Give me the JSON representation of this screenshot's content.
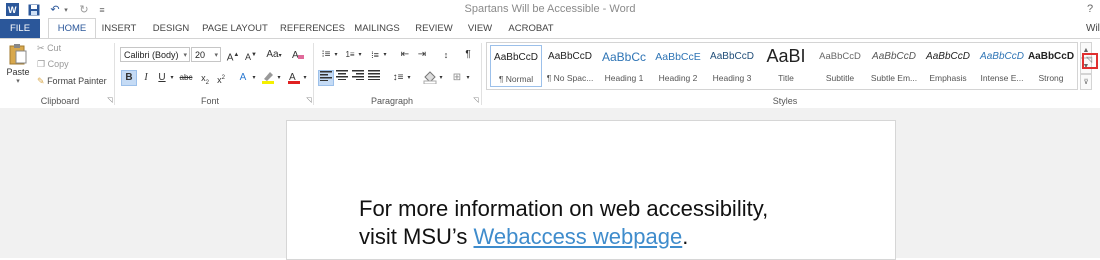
{
  "window": {
    "title": "Spartans Will be Accessible - Word",
    "help": "?",
    "user": "Wil"
  },
  "quick_access": [
    {
      "icon": "word-icon"
    },
    {
      "icon": "save-icon"
    },
    {
      "icon": "undo-icon"
    },
    {
      "icon": "redo-icon"
    },
    {
      "icon": "customize-icon"
    }
  ],
  "tabs": [
    "FILE",
    "HOME",
    "INSERT",
    "DESIGN",
    "PAGE LAYOUT",
    "REFERENCES",
    "MAILINGS",
    "REVIEW",
    "VIEW",
    "ACROBAT"
  ],
  "active_tab": "HOME",
  "clipboard": {
    "paste": "Paste",
    "cut": "Cut",
    "copy": "Copy",
    "format_painter": "Format Painter",
    "label": "Clipboard"
  },
  "font": {
    "family": "Calibri (Body)",
    "size": "20",
    "change_case": "Aa",
    "label": "Font"
  },
  "paragraph": {
    "label": "Paragraph"
  },
  "styles": {
    "label": "Styles",
    "items": [
      {
        "preview": "AaBbCcD",
        "name": "¶ Normal"
      },
      {
        "preview": "AaBbCcD",
        "name": "¶ No Spac..."
      },
      {
        "preview": "AaBbCc",
        "name": "Heading 1"
      },
      {
        "preview": "AaBbCcE",
        "name": "Heading 2"
      },
      {
        "preview": "AaBbCcD",
        "name": "Heading 3"
      },
      {
        "preview": "AaBI",
        "name": "Title"
      },
      {
        "preview": "AaBbCcD",
        "name": "Subtitle"
      },
      {
        "preview": "AaBbCcD",
        "name": "Subtle Em..."
      },
      {
        "preview": "AaBbCcD",
        "name": "Emphasis"
      },
      {
        "preview": "AaBbCcD",
        "name": "Intense E..."
      },
      {
        "preview": "AaBbCcD",
        "name": "Strong"
      }
    ]
  },
  "document": {
    "line1": "For more information on web accessibility,",
    "line2_prefix": "visit MSU’s ",
    "link": "Webaccess webpage",
    "line2_suffix": "."
  },
  "colors": {
    "accent": "#2b579a",
    "highlight_box": "#e03030",
    "link": "#3f8ccc"
  }
}
